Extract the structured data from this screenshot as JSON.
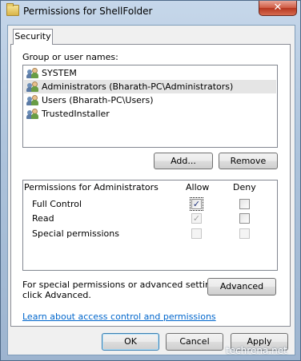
{
  "window": {
    "title": "Permissions for ShellFolder",
    "close_glyph": "✕",
    "folder_icon": "folder-icon",
    "close_icon": "close-icon"
  },
  "tabs": [
    {
      "label": "Security",
      "active": true
    }
  ],
  "users": {
    "label": "Group or user names:",
    "items": [
      {
        "name": "SYSTEM",
        "icon": "user-group-icon",
        "selected": false
      },
      {
        "name": "Administrators (Bharath-PC\\Administrators)",
        "icon": "user-group-icon",
        "selected": true
      },
      {
        "name": "Users (Bharath-PC\\Users)",
        "icon": "user-group-icon",
        "selected": false
      },
      {
        "name": "TrustedInstaller",
        "icon": "user-group-icon",
        "selected": false
      }
    ],
    "add_label": "Add...",
    "remove_label": "Remove"
  },
  "permissions": {
    "header": "Permissions for Administrators",
    "allow_label": "Allow",
    "deny_label": "Deny",
    "rows": [
      {
        "name": "Full Control",
        "allow": true,
        "allow_enabled": true,
        "deny": false,
        "deny_enabled": true
      },
      {
        "name": "Read",
        "allow": true,
        "allow_enabled": false,
        "deny": false,
        "deny_enabled": true
      },
      {
        "name": "Special permissions",
        "allow": false,
        "allow_enabled": false,
        "deny": false,
        "deny_enabled": false
      }
    ]
  },
  "advanced": {
    "line1": "For special permissions or advanced settings,",
    "line2": "click Advanced.",
    "button_label": "Advanced"
  },
  "link": "Learn about access control and permissions",
  "footer": {
    "ok_label": "OK",
    "cancel_label": "Cancel",
    "apply_label": "Apply"
  },
  "watermark": "techrena.net",
  "colors": {
    "link": "#0066cc",
    "selection": "#e5e5e5",
    "close_button": "#c94d36",
    "frame": "#aec4dc"
  }
}
